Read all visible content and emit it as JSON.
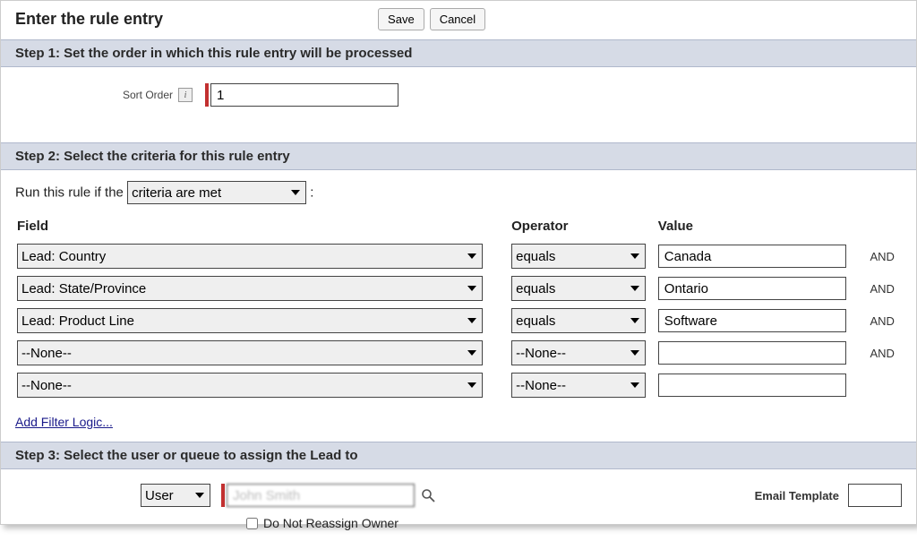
{
  "header": {
    "title": "Enter the rule entry",
    "save": "Save",
    "cancel": "Cancel"
  },
  "step1": {
    "heading": "Step 1: Set the order in which this rule entry will be processed",
    "sortLabel": "Sort Order",
    "sortValue": "1"
  },
  "step2": {
    "heading": "Step 2: Select the criteria for this rule entry",
    "runPrefix": "Run this rule if the",
    "runSelected": "criteria are met",
    "runSuffix": ":",
    "columns": {
      "field": "Field",
      "operator": "Operator",
      "value": "Value"
    },
    "rows": [
      {
        "field": "Lead: Country",
        "operator": "equals",
        "value": "Canada",
        "join": "AND"
      },
      {
        "field": "Lead: State/Province",
        "operator": "equals",
        "value": "Ontario",
        "join": "AND"
      },
      {
        "field": "Lead: Product Line",
        "operator": "equals",
        "value": "Software",
        "join": "AND"
      },
      {
        "field": "--None--",
        "operator": "--None--",
        "value": "",
        "join": "AND"
      },
      {
        "field": "--None--",
        "operator": "--None--",
        "value": "",
        "join": ""
      }
    ],
    "addFilter": "Add Filter Logic..."
  },
  "step3": {
    "heading": "Step 3: Select the user or queue to assign the Lead to",
    "assignType": "User",
    "assignValue": "John Smith",
    "emailLabel": "Email Template",
    "emailValue": "",
    "doNotReassign": "Do Not Reassign Owner",
    "doNotReassignChecked": false
  }
}
